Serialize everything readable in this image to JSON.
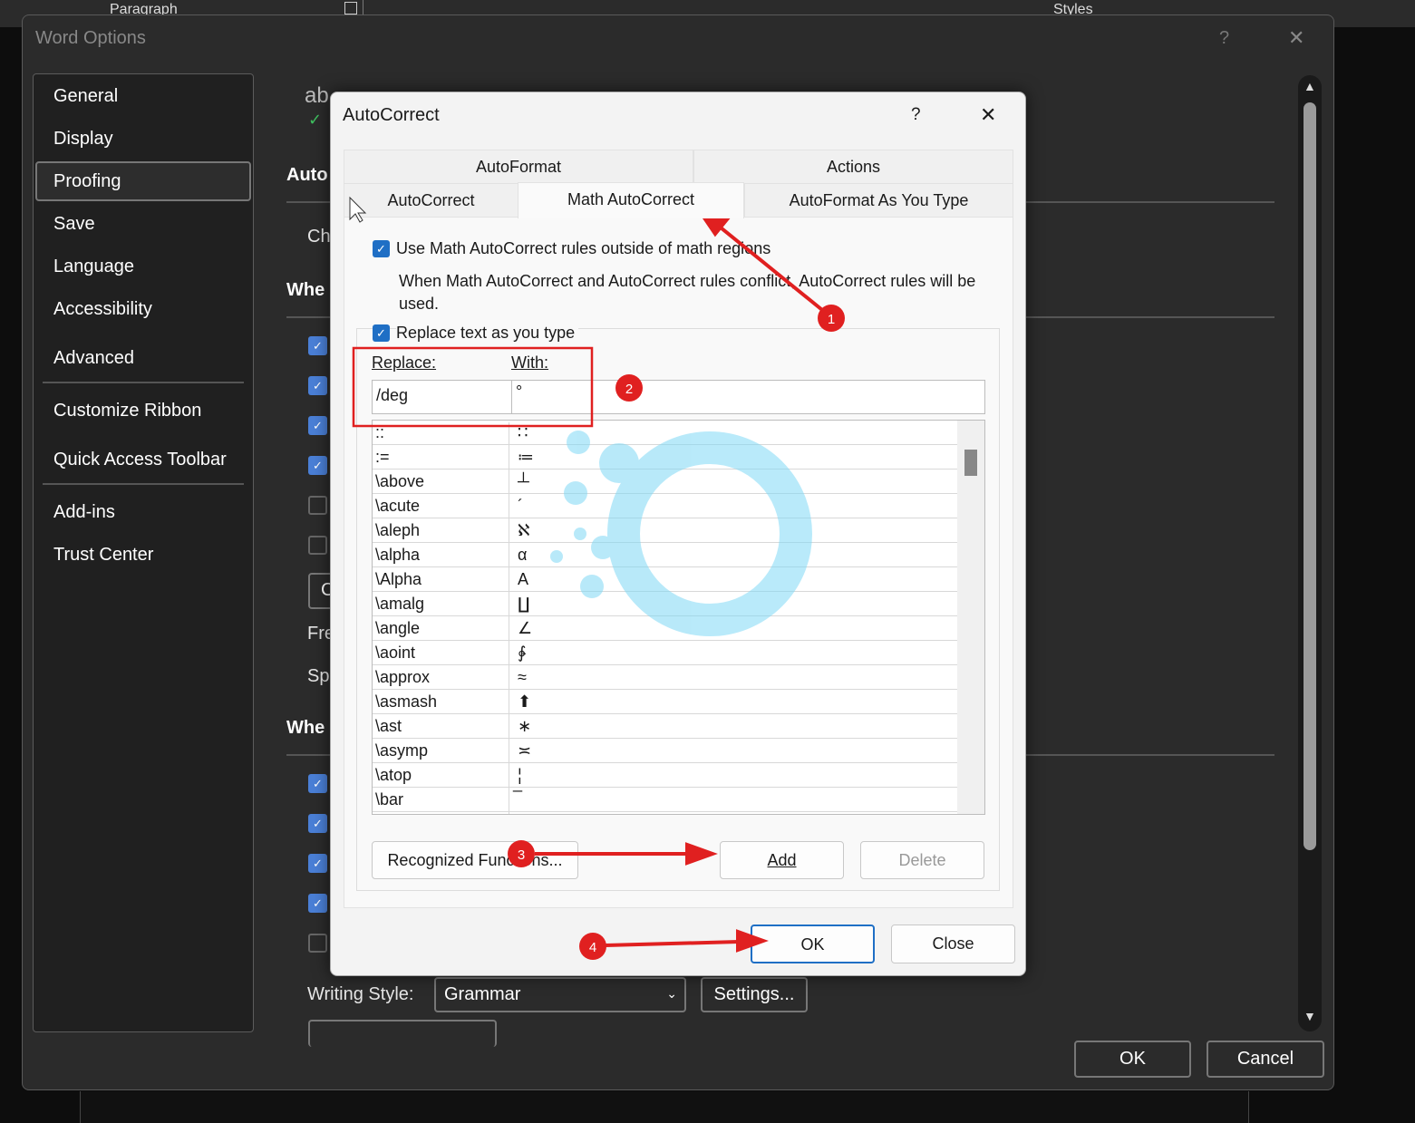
{
  "background_ribbon": {
    "paragraph": "Paragraph",
    "styles": "Styles"
  },
  "word_options": {
    "title": "Word Options",
    "help": "?",
    "close": "✕",
    "nav": [
      "General",
      "Display",
      "Proofing",
      "Save",
      "Language",
      "Accessibility",
      "Advanced",
      "Customize Ribbon",
      "Quick Access Toolbar",
      "Add-ins",
      "Trust Center"
    ],
    "selected": "Proofing",
    "partial": {
      "ab": "ab",
      "auto": "Auto",
      "ch": "Ch",
      "when1": "Whe",
      "c": "C",
      "fre": "Fre",
      "sp": "Sp",
      "when2": "Whe"
    },
    "writing_style_label": "Writing Style:",
    "writing_style_value": "Grammar",
    "settings": "Settings...",
    "ok": "OK",
    "cancel": "Cancel"
  },
  "autocorrect": {
    "title": "AutoCorrect",
    "help": "?",
    "close": "✕",
    "tabs_row1": [
      "AutoFormat",
      "Actions"
    ],
    "tabs_row2": [
      "AutoCorrect",
      "Math AutoCorrect",
      "AutoFormat As You Type"
    ],
    "active_tab": "Math AutoCorrect",
    "use_math_rules": {
      "label": "Use Math AutoCorrect rules outside of math regions",
      "checked": true
    },
    "conflict_note": "When Math AutoCorrect and AutoCorrect rules conflict, AutoCorrect rules will be used.",
    "replace_as_you_type": {
      "label": "Replace text as you type",
      "checked": true
    },
    "replace_label": "Replace:",
    "with_label": "With:",
    "replace_value": "/deg",
    "with_value": "°",
    "entries": [
      {
        "r": "::",
        "w": "∷"
      },
      {
        "r": ":=",
        "w": "≔"
      },
      {
        "r": "\\above",
        "w": "┴"
      },
      {
        "r": "\\acute",
        "w": "´"
      },
      {
        "r": "\\aleph",
        "w": "ℵ"
      },
      {
        "r": "\\alpha",
        "w": "α"
      },
      {
        "r": "\\Alpha",
        "w": "Α"
      },
      {
        "r": "\\amalg",
        "w": "∐"
      },
      {
        "r": "\\angle",
        "w": "∠"
      },
      {
        "r": "\\aoint",
        "w": "∳"
      },
      {
        "r": "\\approx",
        "w": "≈"
      },
      {
        "r": "\\asmash",
        "w": "⬆"
      },
      {
        "r": "\\ast",
        "w": "∗"
      },
      {
        "r": "\\asymp",
        "w": "≍"
      },
      {
        "r": "\\atop",
        "w": "¦"
      },
      {
        "r": "\\bar",
        "w": "̅"
      }
    ],
    "recognized_functions": "Recognized Functions...",
    "add": "Add",
    "delete": "Delete",
    "ok": "OK",
    "close_btn": "Close"
  },
  "annotations": [
    "1",
    "2",
    "3",
    "4"
  ],
  "colors": {
    "annotation_red": "#e02020",
    "check_blue": "#1f6fc5",
    "dark_bg": "#2b2b2b"
  }
}
